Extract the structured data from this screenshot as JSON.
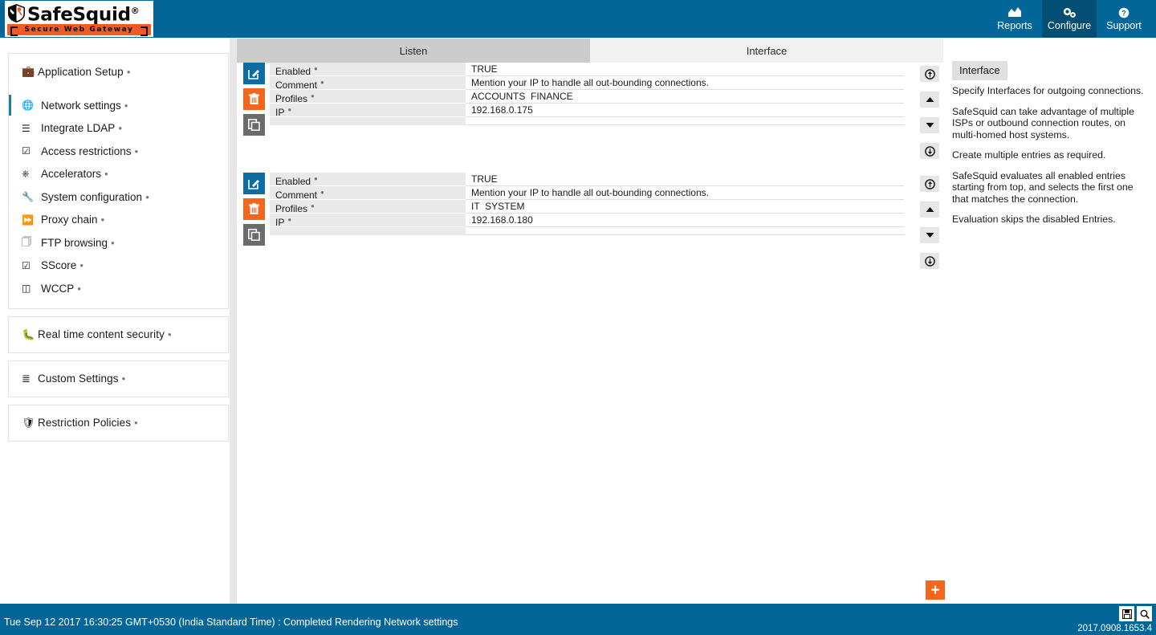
{
  "brand": {
    "name": "SafeSquid",
    "registered": "®",
    "tagline": "Secure Web Gateway",
    "shield_icon": "shield-tools-icon"
  },
  "header": {
    "nav": [
      {
        "label": "Reports",
        "icon": "chart-icon",
        "active": false
      },
      {
        "label": "Configure",
        "icon": "gears-icon",
        "active": true
      },
      {
        "label": "Support",
        "icon": "question-icon",
        "active": false
      }
    ],
    "accent_color": "#026699",
    "active_nav_color": "#024e74"
  },
  "sidebar": {
    "sections": [
      {
        "header": {
          "label": "Application Setup",
          "icon": "briefcase-icon",
          "help": true
        },
        "items": [
          {
            "label": "Network settings",
            "icon": "globe-icon",
            "help": true,
            "active": true
          },
          {
            "label": "Integrate LDAP",
            "icon": "list-icon",
            "help": true,
            "active": false
          },
          {
            "label": "Access restrictions",
            "icon": "checkbox-icon",
            "help": true,
            "active": false
          },
          {
            "label": "Accelerators",
            "icon": "server-icon",
            "help": true,
            "active": false
          },
          {
            "label": "System configuration",
            "icon": "wrench-icon",
            "help": true,
            "active": false
          },
          {
            "label": "Proxy chain",
            "icon": "forward-icon",
            "help": true,
            "active": false
          },
          {
            "label": "FTP browsing",
            "icon": "copy-icon",
            "help": true,
            "active": false
          },
          {
            "label": "SScore",
            "icon": "checkbox-icon",
            "help": true,
            "active": false
          },
          {
            "label": "WCCP",
            "icon": "cards-icon",
            "help": true,
            "active": false
          }
        ]
      },
      {
        "header": {
          "label": "Real time content security",
          "icon": "bug-icon",
          "help": true
        },
        "items": []
      },
      {
        "header": {
          "label": "Custom Settings",
          "icon": "sliders-icon",
          "help": true
        },
        "items": []
      },
      {
        "header": {
          "label": "Restriction Policies",
          "icon": "shield-icon",
          "help": true
        },
        "items": []
      }
    ]
  },
  "main": {
    "tabs": [
      {
        "label": "Listen",
        "active": true
      },
      {
        "label": "Interface",
        "active": false
      }
    ],
    "field_labels": [
      "Enabled",
      "Comment",
      "Profiles",
      "IP"
    ],
    "records": [
      {
        "enabled": "TRUE",
        "comment": "Mention your IP to handle all out-bounding connections.",
        "profiles": "ACCOUNTS  FINANCE",
        "ip": "192.168.0.175"
      },
      {
        "enabled": "TRUE",
        "comment": "Mention your IP to handle all out-bounding connections.",
        "profiles": "IT  SYSTEM",
        "ip": "192.168.0.180"
      }
    ],
    "row_actions": [
      {
        "name": "edit-record-button",
        "icon": "pencil-square-icon",
        "color": "#0d6ca3"
      },
      {
        "name": "delete-record-button",
        "icon": "trash-icon",
        "color": "#f4661b"
      },
      {
        "name": "copy-record-button",
        "icon": "copy-icon",
        "color": "#6b6b6b"
      }
    ],
    "row_nav": [
      {
        "name": "insert-above-button",
        "icon": "circle-up-icon"
      },
      {
        "name": "move-up-button",
        "icon": "triangle-up-icon"
      },
      {
        "name": "move-down-button",
        "icon": "triangle-down-icon"
      },
      {
        "name": "insert-below-button",
        "icon": "circle-down-icon"
      }
    ],
    "add_button": {
      "label": "+",
      "icon": "plus-icon",
      "color": "#f4661b"
    }
  },
  "help": {
    "title": "Interface",
    "paragraphs": [
      "Specify Interfaces for outgoing connections.",
      "SafeSquid can take advantage of multiple ISPs or outbound connection routes, on multi-homed host systems.",
      "Create multiple entries as required.",
      "SafeSquid evaluates all enabled entries starting from top, and selects the first one that matches the connection.",
      "Evaluation skips the disabled Entries."
    ]
  },
  "footer": {
    "status": "Tue Sep 12 2017 16:30:25 GMT+0530 (India Standard Time) : Completed Rendering Network settings",
    "version": "2017.0908.1653.4",
    "buttons": [
      {
        "name": "save-button",
        "icon": "floppy-icon"
      },
      {
        "name": "search-button",
        "icon": "magnifier-icon"
      }
    ]
  }
}
